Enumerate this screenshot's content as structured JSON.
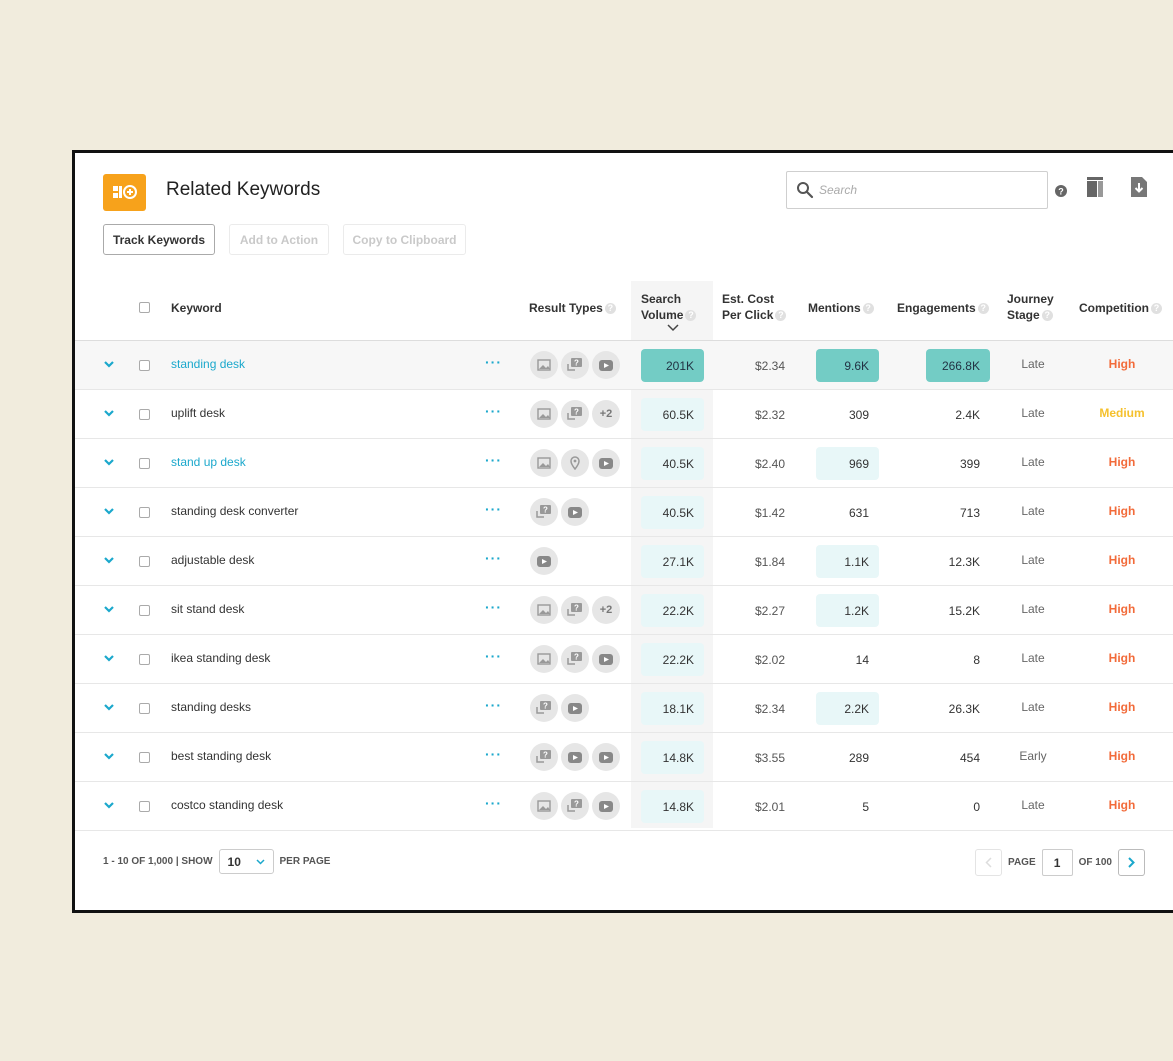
{
  "header": {
    "title": "Related Keywords",
    "search_placeholder": "Search",
    "icons": [
      "search-icon",
      "help-icon",
      "columns-icon",
      "export-icon"
    ]
  },
  "toolbar": {
    "track_keywords": "Track Keywords",
    "add_to_action": "Add to Action",
    "copy_to_clipboard": "Copy to Clipboard"
  },
  "columns": {
    "keyword": "Keyword",
    "result_types": "Result Types",
    "search_volume_1": "Search",
    "search_volume_2": "Volume",
    "cpc_1": "Est. Cost",
    "cpc_2": "Per Click",
    "mentions": "Mentions",
    "engagements": "Engagements",
    "journey_1": "Journey",
    "journey_2": "Stage",
    "competition": "Competition"
  },
  "rows": [
    {
      "keyword": "standing desk",
      "link": true,
      "types": [
        "image",
        "qa",
        "video"
      ],
      "search_volume": "201K",
      "cpc": "$2.34",
      "mentions": "9.6K",
      "engagements": "266.8K",
      "journey": "Late",
      "competition": "High"
    },
    {
      "keyword": "uplift desk",
      "link": false,
      "types": [
        "image",
        "qa",
        "+2"
      ],
      "search_volume": "60.5K",
      "cpc": "$2.32",
      "mentions": "309",
      "engagements": "2.4K",
      "journey": "Late",
      "competition": "Medium"
    },
    {
      "keyword": "stand up desk",
      "link": true,
      "types": [
        "image",
        "location",
        "video"
      ],
      "search_volume": "40.5K",
      "cpc": "$2.40",
      "mentions": "969",
      "engagements": "399",
      "journey": "Late",
      "competition": "High"
    },
    {
      "keyword": "standing desk converter",
      "link": false,
      "types": [
        "qa",
        "video"
      ],
      "search_volume": "40.5K",
      "cpc": "$1.42",
      "mentions": "631",
      "engagements": "713",
      "journey": "Late",
      "competition": "High"
    },
    {
      "keyword": "adjustable desk",
      "link": false,
      "types": [
        "video"
      ],
      "search_volume": "27.1K",
      "cpc": "$1.84",
      "mentions": "1.1K",
      "engagements": "12.3K",
      "journey": "Late",
      "competition": "High"
    },
    {
      "keyword": "sit stand desk",
      "link": false,
      "types": [
        "image",
        "qa",
        "+2"
      ],
      "search_volume": "22.2K",
      "cpc": "$2.27",
      "mentions": "1.2K",
      "engagements": "15.2K",
      "journey": "Late",
      "competition": "High"
    },
    {
      "keyword": "ikea standing desk",
      "link": false,
      "types": [
        "image",
        "qa",
        "video"
      ],
      "search_volume": "22.2K",
      "cpc": "$2.02",
      "mentions": "14",
      "engagements": "8",
      "journey": "Late",
      "competition": "High"
    },
    {
      "keyword": "standing desks",
      "link": false,
      "types": [
        "qa",
        "video"
      ],
      "search_volume": "18.1K",
      "cpc": "$2.34",
      "mentions": "2.2K",
      "engagements": "26.3K",
      "journey": "Late",
      "competition": "High"
    },
    {
      "keyword": "best standing desk",
      "link": false,
      "types": [
        "qa",
        "video",
        "video"
      ],
      "search_volume": "14.8K",
      "cpc": "$3.55",
      "mentions": "289",
      "engagements": "454",
      "journey": "Early",
      "competition": "High"
    },
    {
      "keyword": "costco standing desk",
      "link": false,
      "types": [
        "image",
        "qa",
        "video"
      ],
      "search_volume": "14.8K",
      "cpc": "$2.01",
      "mentions": "5",
      "engagements": "0",
      "journey": "Late",
      "competition": "High"
    }
  ],
  "highlights": {
    "search_volume": [
      "strong",
      "light",
      "light",
      "light",
      "light",
      "light",
      "light",
      "light",
      "light",
      "light"
    ],
    "mentions": [
      "strong",
      "none",
      "light",
      "none",
      "light",
      "light",
      "none",
      "light",
      "none",
      "none"
    ],
    "engagements": [
      "strong",
      "none",
      "none",
      "none",
      "none",
      "none",
      "none",
      "none",
      "none",
      "none"
    ]
  },
  "colors": {
    "accent": "#1ba8cc",
    "logo": "#f7a21b",
    "high": "#f26b3a",
    "medium": "#f5c12e",
    "highlight_strong": "#73ccc5",
    "highlight_light": "#e8f7f8"
  },
  "footer": {
    "range": "1 - 10 OF 1,000 | SHOW",
    "per_page_value": "10",
    "per_page_label": "PER PAGE",
    "page_label": "PAGE",
    "page_value": "1",
    "of_pages": "OF 100"
  }
}
